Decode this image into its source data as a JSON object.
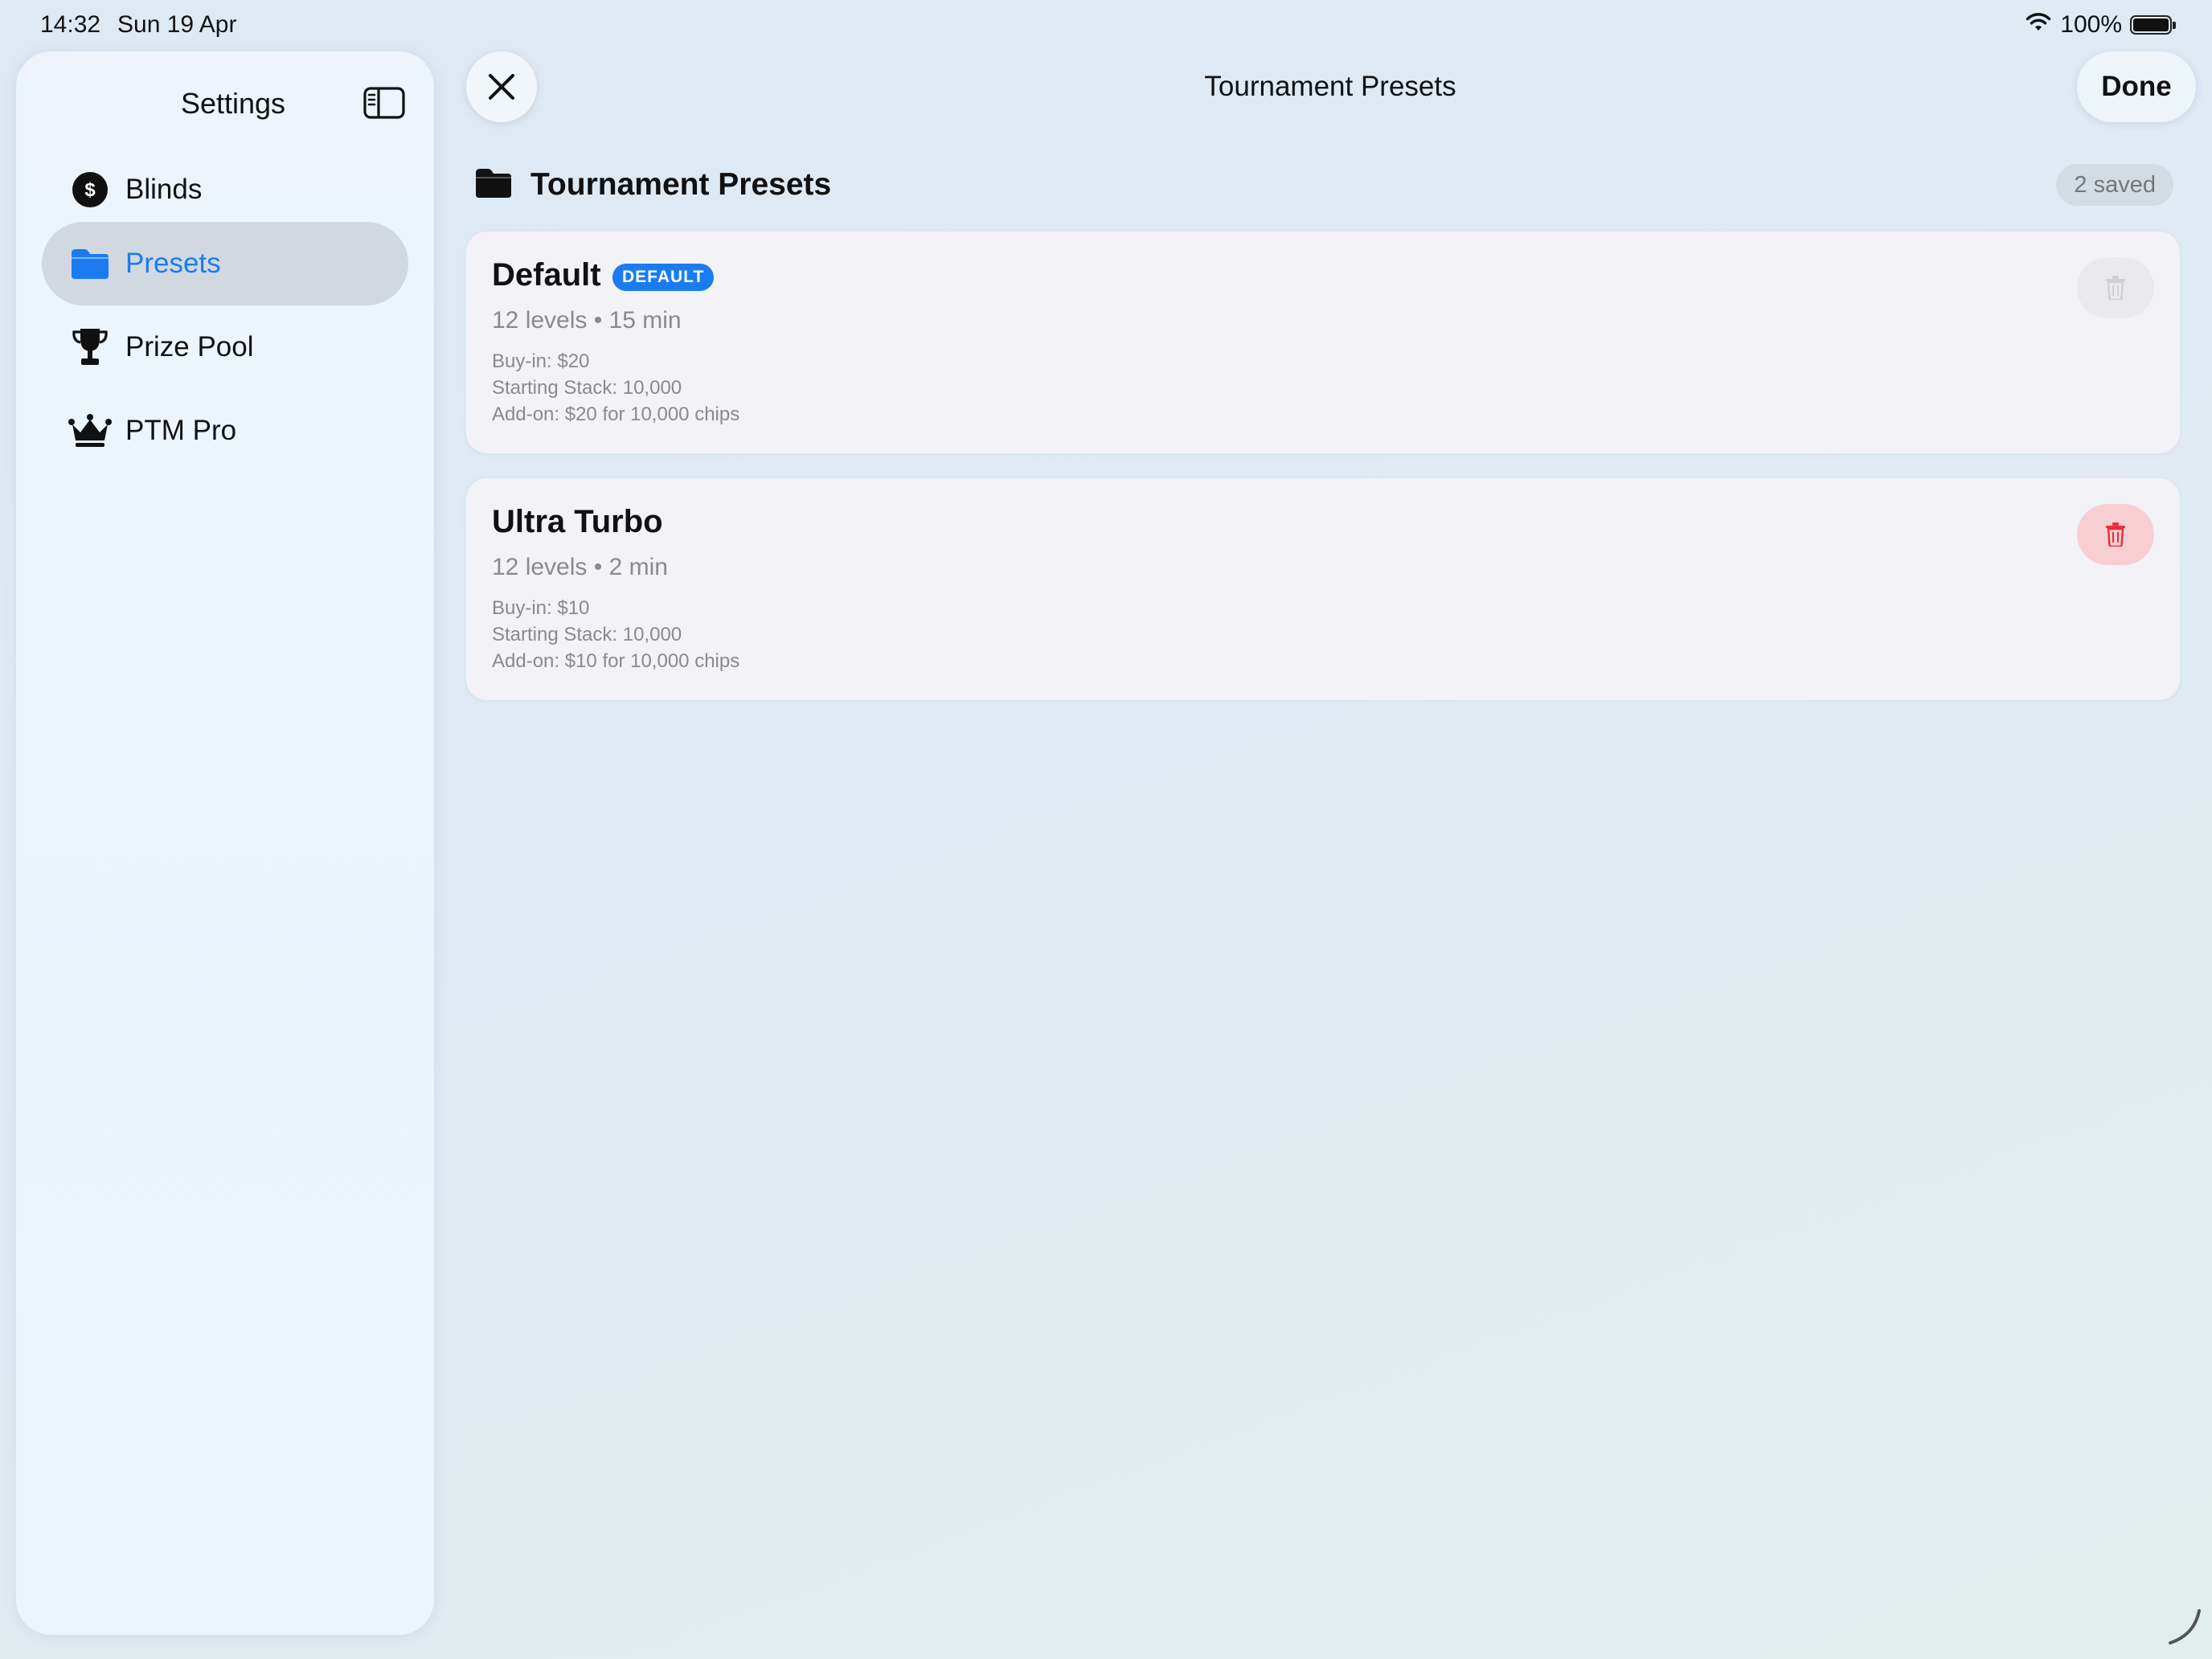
{
  "status_bar": {
    "time": "14:32",
    "date": "Sun 19 Apr",
    "battery": "100%",
    "battery_level": 1.0
  },
  "sidebar": {
    "title": "Settings",
    "items": [
      {
        "label": "Blinds",
        "icon": "dollar-circle-icon",
        "active": false
      },
      {
        "label": "Presets",
        "icon": "folder-icon",
        "active": true
      },
      {
        "label": "Prize Pool",
        "icon": "trophy-icon",
        "active": false
      },
      {
        "label": "PTM Pro",
        "icon": "crown-icon",
        "active": false
      }
    ]
  },
  "topbar": {
    "title": "Tournament Presets",
    "done_label": "Done"
  },
  "section": {
    "title": "Tournament Presets",
    "saved_count": "2 saved"
  },
  "presets": [
    {
      "name": "Default",
      "badge": "DEFAULT",
      "summary": "12 levels • 15 min",
      "buy_in": "Buy-in: $20",
      "starting_stack": "Starting Stack: 10,000",
      "add_on": "Add-on: $20 for 10,000 chips",
      "delete_enabled": false
    },
    {
      "name": "Ultra Turbo",
      "summary": "12 levels • 2 min",
      "buy_in": "Buy-in: $10",
      "starting_stack": "Starting Stack: 10,000",
      "add_on": "Add-on: $10 for 10,000 chips",
      "delete_enabled": true
    }
  ],
  "colors": {
    "accent": "#1a7cf0",
    "danger": "#e5303a",
    "danger_bg": "#f7cfd3",
    "selected_bg": "#d1d8df"
  }
}
